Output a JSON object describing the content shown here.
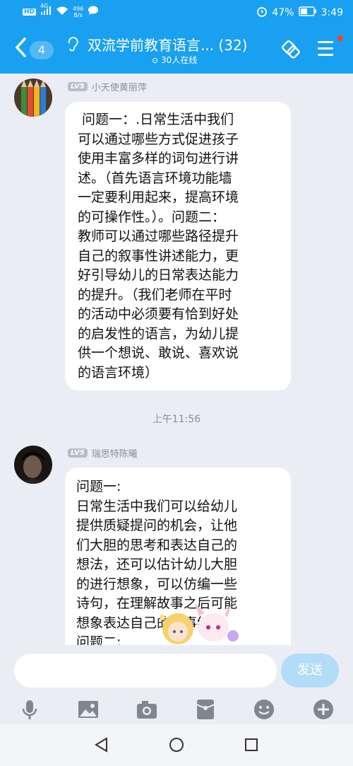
{
  "status_bar": {
    "hd": "HD",
    "signal_type": "4G",
    "net_speed_value": "496",
    "net_speed_unit": "B/s",
    "battery": "47%",
    "time": "3:49"
  },
  "header": {
    "unread_count": "4",
    "group_name": "双流学前教育语言... (32)",
    "online_count": "30人在线"
  },
  "messages": [
    {
      "level": "LV5",
      "sender": "小天使黄丽萍",
      "text": " 问题一：.日常生活中我们\n可以通过哪些方式促进孩子\n使用丰富多样的词句进行讲\n述。（首先语言环境功能墙\n一定要利用起来，提高环境\n的可操作性。）。问题二：\n教师可以通过哪些路径提升\n自己的叙事性讲述能力，更\n好引导幼儿的日常表达能力\n的提升。（我们老师在平时\n的活动中必须要有恰到好处\n的启发性的语言，为幼儿提\n供一个想说、敢说、喜欢说\n的语言环境）"
    },
    {
      "level": "LV5",
      "sender": "瑞思特陈曦",
      "text": "问题一:\n日常生活中我们可以给幼儿\n提供质疑提问的机会，让他\n们大胆的思考和表达自己的\n想法，还可以估计幼儿大胆\n的进行想象，可以仿编一些\n诗句，在理解故事之后可能\n想象表达自己的故事结尾。\n问题二:"
    }
  ],
  "timestamp": "上午11:56",
  "input": {
    "value": "",
    "send_label": "发送"
  },
  "toolbar_icons": [
    "microphone-icon",
    "image-icon",
    "camera-icon",
    "red-packet-icon",
    "emoji-icon",
    "plus-icon"
  ],
  "colors": {
    "header_blue": "#1aa0f0",
    "background": "#ebedf5",
    "send_disabled": "#b3dcf7"
  }
}
